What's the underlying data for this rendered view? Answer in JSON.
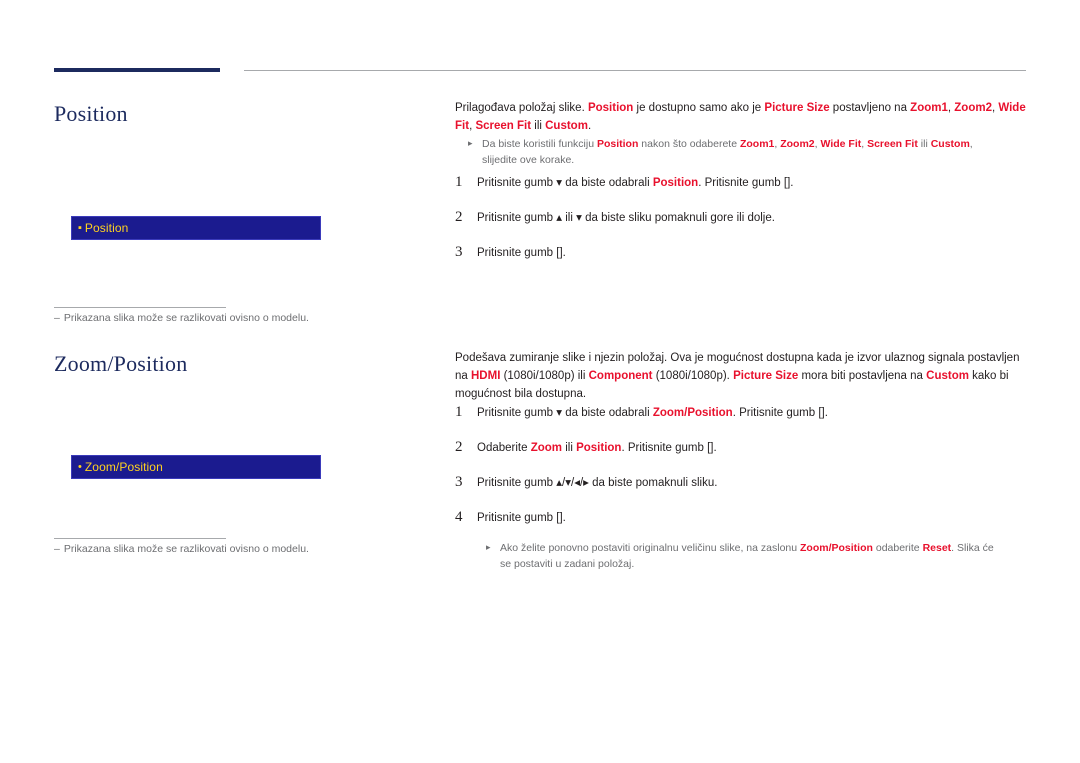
{
  "document": {
    "sections": [
      {
        "id": "position",
        "title": "Position",
        "osd": {
          "bullet": "▪",
          "label": "Position"
        },
        "note": {
          "dash": "–",
          "text": "Prikazana slika može se razlikovati ovisno o modelu."
        },
        "intro_parts": [
          {
            "t": "Prilagođava položaj slike. ",
            "s": "plain"
          },
          {
            "t": "Position",
            "s": "red-bold"
          },
          {
            "t": " je dostupno samo ako je ",
            "s": "plain"
          },
          {
            "t": "Picture Size",
            "s": "red-bold"
          },
          {
            "t": " postavljeno na ",
            "s": "plain"
          },
          {
            "t": "Zoom1",
            "s": "red-bold"
          },
          {
            "t": ", ",
            "s": "plain"
          },
          {
            "t": "Zoom2",
            "s": "red-bold"
          },
          {
            "t": ", ",
            "s": "plain"
          },
          {
            "t": "Wide Fit",
            "s": "red-bold"
          },
          {
            "t": ", ",
            "s": "plain"
          },
          {
            "t": "Screen Fit",
            "s": "red-bold"
          },
          {
            "t": " ili ",
            "s": "plain"
          },
          {
            "t": "Custom",
            "s": "red-bold"
          },
          {
            "t": ".",
            "s": "plain"
          }
        ],
        "subnote_parts": [
          {
            "t": "Da biste koristili funkciju ",
            "s": "plain"
          },
          {
            "t": "Position",
            "s": "red-bold"
          },
          {
            "t": " nakon što odaberete ",
            "s": "plain"
          },
          {
            "t": "Zoom1",
            "s": "red-bold"
          },
          {
            "t": ", ",
            "s": "plain"
          },
          {
            "t": "Zoom2",
            "s": "red-bold"
          },
          {
            "t": ", ",
            "s": "plain"
          },
          {
            "t": "Wide Fit",
            "s": "red-bold"
          },
          {
            "t": ", ",
            "s": "plain"
          },
          {
            "t": "Screen Fit",
            "s": "red-bold"
          },
          {
            "t": " ili ",
            "s": "plain"
          },
          {
            "t": "Custom",
            "s": "red-bold"
          },
          {
            "t": ", slijedite ove korake.",
            "s": "plain"
          }
        ],
        "steps": [
          {
            "num": "1",
            "parts": [
              {
                "t": "Pritisnite gumb ",
                "s": "plain"
              },
              {
                "t": "▾",
                "s": "plain"
              },
              {
                "t": " da biste odabrali ",
                "s": "plain"
              },
              {
                "t": "Position",
                "s": "red-bold"
              },
              {
                "t": ". Pritisnite gumb ",
                "s": "plain"
              },
              {
                "t": "[\u0001]",
                "s": "plain"
              },
              {
                "t": ".",
                "s": "plain"
              }
            ]
          },
          {
            "num": "2",
            "parts": [
              {
                "t": "Pritisnite gumb ",
                "s": "plain"
              },
              {
                "t": "▴",
                "s": "plain"
              },
              {
                "t": " ili ",
                "s": "plain"
              },
              {
                "t": "▾",
                "s": "plain"
              },
              {
                "t": " da biste sliku pomaknuli gore ili dolje.",
                "s": "plain"
              }
            ]
          },
          {
            "num": "3",
            "parts": [
              {
                "t": "Pritisnite gumb ",
                "s": "plain"
              },
              {
                "t": "[\u0001]",
                "s": "plain"
              },
              {
                "t": ".",
                "s": "plain"
              }
            ]
          }
        ]
      },
      {
        "id": "zoom-position",
        "title": "Zoom/Position",
        "osd": {
          "bullet": "•",
          "label": "Zoom/Position"
        },
        "note": {
          "dash": "–",
          "text": "Prikazana slika može se razlikovati ovisno o modelu."
        },
        "intro_parts": [
          {
            "t": "Podešava zumiranje slike i njezin položaj. Ova je mogućnost dostupna kada je izvor ulaznog signala postavljen na ",
            "s": "plain"
          },
          {
            "t": "HDMI",
            "s": "red-bold"
          },
          {
            "t": " (1080i/1080p) ili ",
            "s": "plain"
          },
          {
            "t": "Component",
            "s": "red-bold"
          },
          {
            "t": " (1080i/1080p). ",
            "s": "plain"
          },
          {
            "t": "Picture Size",
            "s": "red-bold"
          },
          {
            "t": " mora biti postavljena na ",
            "s": "plain"
          },
          {
            "t": "Custom",
            "s": "red-bold"
          },
          {
            "t": " kako bi mogućnost bila dostupna.",
            "s": "plain"
          }
        ],
        "steps": [
          {
            "num": "1",
            "parts": [
              {
                "t": "Pritisnite gumb ",
                "s": "plain"
              },
              {
                "t": "▾",
                "s": "plain"
              },
              {
                "t": " da biste odabrali ",
                "s": "plain"
              },
              {
                "t": "Zoom/Position",
                "s": "red-bold"
              },
              {
                "t": ". Pritisnite gumb ",
                "s": "plain"
              },
              {
                "t": "[\u0001]",
                "s": "plain"
              },
              {
                "t": ".",
                "s": "plain"
              }
            ]
          },
          {
            "num": "2",
            "parts": [
              {
                "t": "Odaberite ",
                "s": "plain"
              },
              {
                "t": "Zoom",
                "s": "red-bold"
              },
              {
                "t": " ili ",
                "s": "plain"
              },
              {
                "t": "Position",
                "s": "red-bold"
              },
              {
                "t": ". Pritisnite gumb ",
                "s": "plain"
              },
              {
                "t": "[\u0001]",
                "s": "plain"
              },
              {
                "t": ".",
                "s": "plain"
              }
            ]
          },
          {
            "num": "3",
            "parts": [
              {
                "t": "Pritisnite gumb ",
                "s": "plain"
              },
              {
                "t": "▴/▾/◂/▸",
                "s": "plain"
              },
              {
                "t": " da biste pomaknuli sliku.",
                "s": "plain"
              }
            ]
          },
          {
            "num": "4",
            "parts": [
              {
                "t": "Pritisnite gumb ",
                "s": "plain"
              },
              {
                "t": "[\u0001]",
                "s": "plain"
              },
              {
                "t": ".",
                "s": "plain"
              }
            ]
          }
        ],
        "subnote_parts": [
          {
            "t": "Ako želite ponovno postaviti originalnu veličinu slike, na zaslonu ",
            "s": "plain"
          },
          {
            "t": "Zoom/Position",
            "s": "red-bold"
          },
          {
            "t": " odaberite ",
            "s": "plain"
          },
          {
            "t": "Reset",
            "s": "red-bold"
          },
          {
            "t": ". Slika će se postaviti u zadani položaj.",
            "s": "plain"
          }
        ]
      }
    ]
  },
  "colors": {
    "accent_navy": "#1c2a5e",
    "osd_background": "#1b1b8f",
    "osd_text": "#ffd21f",
    "highlight_red": "#e8112d",
    "note_gray": "#6d6e71"
  }
}
